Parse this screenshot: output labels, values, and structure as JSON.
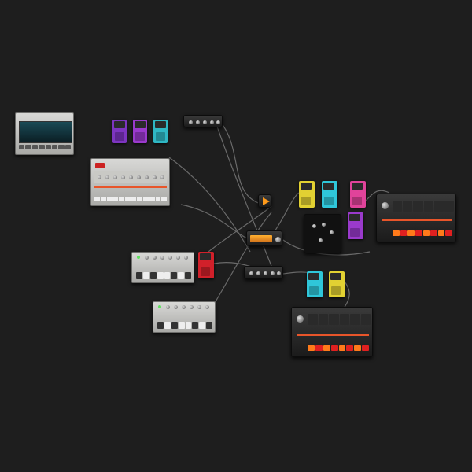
{
  "canvas": {
    "background": "#1e1e1e",
    "cable_color": "#6a6a6a"
  },
  "modules": {
    "synth_panel": {
      "icon": "synth-icon"
    },
    "drum_machine_silver": {
      "logo": "909"
    },
    "bass_synth_1": {
      "icon": "bass-synth-icon"
    },
    "bass_synth_2": {
      "icon": "bass-synth-icon"
    },
    "drum_machine_dark_1": {
      "icon": "drum-machine-icon"
    },
    "drum_machine_dark_2": {
      "icon": "drum-machine-icon"
    },
    "play_button": {
      "icon": "play-icon"
    },
    "display_module": {
      "icon": "display-icon"
    }
  },
  "pedal_colors": {
    "purple": "#8a3bd1",
    "magenta": "#b13bd1",
    "teal": "#2fb7c4",
    "yellow": "#e2d132",
    "cyan": "#2fc6d9",
    "pink": "#e0439a",
    "orange": "#f0a020",
    "red": "#d1202a"
  },
  "accent_colors": {
    "led_green": "#5fe35f",
    "step_orange": "#ff7a1a",
    "step_red": "#e02020",
    "play_orange": "#ff9a1a"
  }
}
